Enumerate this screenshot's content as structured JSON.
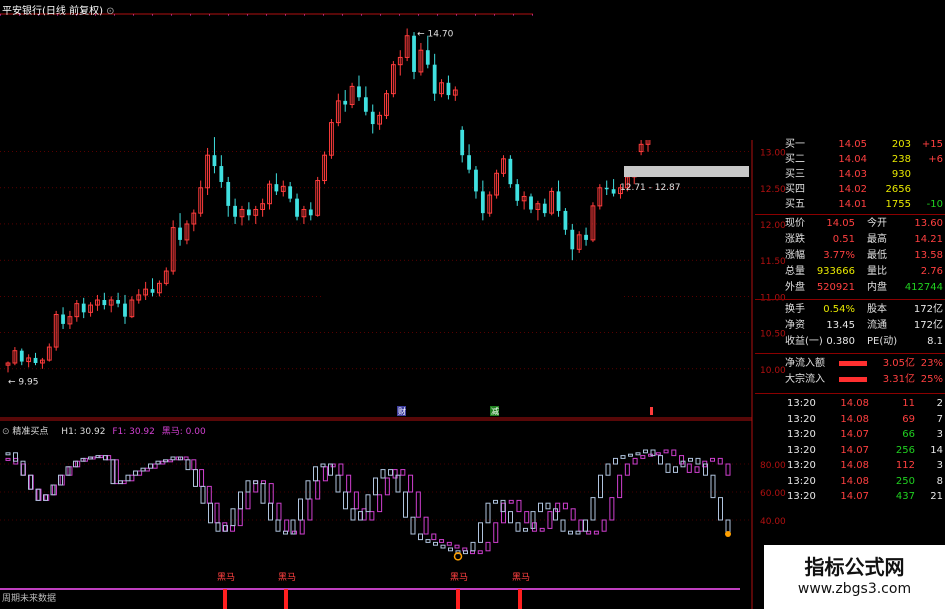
{
  "chart_title": "平安银行(日线 前复权)",
  "chart_data": [
    {
      "type": "candlestick",
      "title": "平安银行(日线 前复权)",
      "ylim": [
        9.5,
        14.9
      ],
      "y_ticks": [
        "13.00",
        "12.50",
        "12.00",
        "11.50",
        "11.00",
        "10.50",
        "10.00"
      ],
      "annotations": [
        "14.70",
        "9.95",
        "12.71 - 12.87"
      ],
      "markers": [
        "财",
        "减"
      ],
      "up_color": "#ff3c3c",
      "down_color": "#40e0e0",
      "candles": [
        [
          10.05,
          10.1,
          9.95,
          10.08
        ],
        [
          10.08,
          10.3,
          10.05,
          10.25
        ],
        [
          10.25,
          10.28,
          10.05,
          10.1
        ],
        [
          10.1,
          10.2,
          10.02,
          10.15
        ],
        [
          10.15,
          10.22,
          10.05,
          10.08
        ],
        [
          10.08,
          10.15,
          10.0,
          10.12
        ],
        [
          10.12,
          10.35,
          10.1,
          10.3
        ],
        [
          10.3,
          10.8,
          10.25,
          10.75
        ],
        [
          10.75,
          10.85,
          10.55,
          10.62
        ],
        [
          10.62,
          10.8,
          10.55,
          10.72
        ],
        [
          10.72,
          10.95,
          10.65,
          10.9
        ],
        [
          10.9,
          10.98,
          10.7,
          10.78
        ],
        [
          10.78,
          10.92,
          10.72,
          10.88
        ],
        [
          10.88,
          11.02,
          10.8,
          10.95
        ],
        [
          10.95,
          11.05,
          10.82,
          10.88
        ],
        [
          10.88,
          11.0,
          10.78,
          10.95
        ],
        [
          10.95,
          11.05,
          10.85,
          10.9
        ],
        [
          10.9,
          11.02,
          10.62,
          10.72
        ],
        [
          10.72,
          11.0,
          10.7,
          10.95
        ],
        [
          10.95,
          11.1,
          10.9,
          11.02
        ],
        [
          11.02,
          11.2,
          10.95,
          11.1
        ],
        [
          11.1,
          11.25,
          11.0,
          11.05
        ],
        [
          11.05,
          11.22,
          11.0,
          11.18
        ],
        [
          11.18,
          11.4,
          11.15,
          11.35
        ],
        [
          11.35,
          12.05,
          11.3,
          11.95
        ],
        [
          11.95,
          12.15,
          11.7,
          11.78
        ],
        [
          11.78,
          12.05,
          11.72,
          12.0
        ],
        [
          12.0,
          12.2,
          11.9,
          12.15
        ],
        [
          12.15,
          12.6,
          12.1,
          12.5
        ],
        [
          12.5,
          13.05,
          12.4,
          12.95
        ],
        [
          12.95,
          13.2,
          12.7,
          12.8
        ],
        [
          12.8,
          12.95,
          12.5,
          12.58
        ],
        [
          12.58,
          12.65,
          12.1,
          12.25
        ],
        [
          12.25,
          12.35,
          12.0,
          12.1
        ],
        [
          12.1,
          12.25,
          11.98,
          12.2
        ],
        [
          12.2,
          12.3,
          12.05,
          12.12
        ],
        [
          12.12,
          12.25,
          12.0,
          12.2
        ],
        [
          12.2,
          12.35,
          12.1,
          12.28
        ],
        [
          12.28,
          12.6,
          12.2,
          12.55
        ],
        [
          12.55,
          12.7,
          12.4,
          12.45
        ],
        [
          12.45,
          12.6,
          12.38,
          12.52
        ],
        [
          12.52,
          12.58,
          12.3,
          12.35
        ],
        [
          12.35,
          12.42,
          12.05,
          12.1
        ],
        [
          12.1,
          12.25,
          12.0,
          12.2
        ],
        [
          12.2,
          12.3,
          12.05,
          12.12
        ],
        [
          12.12,
          12.65,
          12.1,
          12.6
        ],
        [
          12.6,
          13.0,
          12.55,
          12.95
        ],
        [
          12.95,
          13.45,
          12.9,
          13.4
        ],
        [
          13.4,
          13.8,
          13.35,
          13.7
        ],
        [
          13.7,
          13.85,
          13.55,
          13.65
        ],
        [
          13.65,
          13.95,
          13.6,
          13.9
        ],
        [
          13.9,
          14.05,
          13.7,
          13.75
        ],
        [
          13.75,
          13.9,
          13.5,
          13.55
        ],
        [
          13.55,
          13.65,
          13.25,
          13.38
        ],
        [
          13.38,
          13.55,
          13.3,
          13.5
        ],
        [
          13.5,
          13.85,
          13.45,
          13.8
        ],
        [
          13.8,
          14.25,
          13.75,
          14.2
        ],
        [
          14.2,
          14.4,
          14.05,
          14.3
        ],
        [
          14.3,
          14.7,
          14.25,
          14.6
        ],
        [
          14.6,
          14.65,
          14.0,
          14.1
        ],
        [
          14.1,
          14.5,
          14.05,
          14.4
        ],
        [
          14.4,
          14.6,
          14.15,
          14.2
        ],
        [
          14.2,
          14.35,
          13.7,
          13.8
        ],
        [
          13.8,
          14.0,
          13.75,
          13.95
        ],
        [
          13.95,
          14.05,
          13.72,
          13.78
        ],
        [
          13.78,
          13.9,
          13.7,
          13.85
        ],
        [
          13.3,
          13.35,
          12.85,
          12.95
        ],
        [
          12.95,
          13.1,
          12.7,
          12.75
        ],
        [
          12.75,
          12.8,
          12.35,
          12.45
        ],
        [
          12.45,
          12.6,
          12.05,
          12.15
        ],
        [
          12.15,
          12.45,
          12.1,
          12.4
        ],
        [
          12.4,
          12.75,
          12.35,
          12.7
        ],
        [
          12.7,
          12.95,
          12.65,
          12.9
        ],
        [
          12.9,
          12.95,
          12.5,
          12.55
        ],
        [
          12.55,
          12.62,
          12.25,
          12.32
        ],
        [
          12.32,
          12.45,
          12.2,
          12.38
        ],
        [
          12.38,
          12.42,
          12.15,
          12.2
        ],
        [
          12.2,
          12.32,
          12.05,
          12.28
        ],
        [
          12.28,
          12.35,
          12.1,
          12.15
        ],
        [
          12.15,
          12.5,
          12.12,
          12.45
        ],
        [
          12.45,
          12.6,
          12.1,
          12.18
        ],
        [
          12.18,
          12.22,
          11.85,
          11.92
        ],
        [
          11.92,
          12.0,
          11.5,
          11.65
        ],
        [
          11.65,
          11.9,
          11.6,
          11.85
        ],
        [
          11.85,
          11.95,
          11.7,
          11.78
        ],
        [
          11.78,
          12.3,
          11.75,
          12.25
        ],
        [
          12.25,
          12.55,
          12.2,
          12.5
        ],
        [
          12.5,
          12.6,
          12.4,
          12.48
        ],
        [
          12.48,
          12.62,
          12.38,
          12.42
        ],
        [
          12.42,
          12.55,
          12.35,
          12.5
        ],
        [
          12.5,
          12.7,
          12.45,
          12.65
        ],
        [
          12.65,
          12.8,
          12.55,
          12.71
        ],
        [
          13.0,
          13.3,
          12.95,
          13.1
        ],
        [
          13.1,
          13.4,
          13.0,
          13.3
        ]
      ]
    },
    {
      "type": "line",
      "title": "精准买点",
      "legend": [
        "H1: 30.92",
        "F1: 30.92",
        "黑马: 0.00"
      ],
      "ylim": [
        0,
        100
      ],
      "y_ticks": [
        "80.00",
        "60.00",
        "40.00"
      ],
      "marker_label": "黑马",
      "marker_positions": [
        18,
        22,
        38,
        43
      ],
      "series": [
        {
          "name": "H1",
          "color": "#d040d0",
          "values": [
            84,
            80,
            72,
            62,
            54,
            58,
            65,
            72,
            78,
            82,
            84,
            85,
            86,
            83,
            66,
            68,
            72,
            75,
            77,
            80,
            82,
            83,
            85,
            83,
            76,
            64,
            52,
            38,
            32,
            36,
            48,
            60,
            68,
            66,
            52,
            40,
            32,
            30,
            40,
            55,
            68,
            78,
            80,
            72,
            60,
            48,
            40,
            46,
            58,
            70,
            76,
            72,
            60,
            42,
            30,
            26,
            24,
            22,
            20,
            18,
            16,
            18,
            24,
            38,
            52,
            54,
            46,
            38,
            32,
            34,
            46,
            52,
            48,
            40,
            32,
            30,
            32,
            40,
            56,
            72,
            80,
            84,
            86,
            87,
            88,
            90,
            86,
            80,
            74,
            78,
            82,
            84,
            80,
            72
          ]
        },
        {
          "name": "F1",
          "color": "#b0c4de",
          "values": [
            88,
            82,
            72,
            62,
            54,
            58,
            65,
            72,
            78,
            82,
            84,
            85,
            86,
            83,
            66,
            68,
            72,
            75,
            77,
            80,
            82,
            83,
            85,
            83,
            76,
            64,
            52,
            38,
            32,
            36,
            48,
            60,
            68,
            66,
            52,
            40,
            32,
            30,
            40,
            55,
            68,
            78,
            80,
            72,
            60,
            48,
            40,
            46,
            58,
            70,
            76,
            72,
            60,
            42,
            30,
            26,
            24,
            22,
            20,
            18,
            16,
            18,
            24,
            38,
            52,
            54,
            46,
            38,
            32,
            34,
            46,
            52,
            48,
            40,
            32,
            30,
            32,
            40,
            56,
            72,
            80,
            84,
            86,
            87,
            88,
            90,
            86,
            80,
            74,
            78,
            82,
            84,
            80,
            72,
            56,
            40,
            30
          ]
        }
      ]
    }
  ],
  "quote_panel": {
    "bids": [
      {
        "label": "买一",
        "price": "14.05",
        "vol": "203",
        "chg": "+15"
      },
      {
        "label": "买二",
        "price": "14.04",
        "vol": "238",
        "chg": "+6"
      },
      {
        "label": "买三",
        "price": "14.03",
        "vol": "930",
        "chg": ""
      },
      {
        "label": "买四",
        "price": "14.02",
        "vol": "2656",
        "chg": ""
      },
      {
        "label": "买五",
        "price": "14.01",
        "vol": "1755",
        "chg": "-10"
      }
    ],
    "stats": [
      {
        "l1": "现价",
        "v1": "14.05",
        "l2": "今开",
        "v2": "13.60"
      },
      {
        "l1": "涨跌",
        "v1": "0.51",
        "l2": "最高",
        "v2": "14.21"
      },
      {
        "l1": "涨幅",
        "v1": "3.77%",
        "l2": "最低",
        "v2": "13.58"
      },
      {
        "l1": "总量",
        "v1": "933666",
        "l2": "量比",
        "v2": "2.76"
      },
      {
        "l1": "外盘",
        "v1": "520921",
        "l2": "内盘",
        "v2": "412744"
      }
    ],
    "stats2": [
      {
        "l1": "换手",
        "v1": "0.54%",
        "l2": "股本",
        "v2": "172亿"
      },
      {
        "l1": "净资",
        "v1": "13.45",
        "l2": "流通",
        "v2": "172亿"
      },
      {
        "l1": "收益(一)",
        "v1": "0.380",
        "l2": "PE(动)",
        "v2": "8.1"
      }
    ],
    "flows": [
      {
        "label": "净流入额",
        "value": "3.05亿",
        "pct": "23%"
      },
      {
        "label": "大宗流入",
        "value": "3.31亿",
        "pct": "25%"
      }
    ],
    "ticks": [
      {
        "time": "13:20",
        "price": "14.08",
        "vol": "11",
        "dir": "2"
      },
      {
        "time": "13:20",
        "price": "14.08",
        "vol": "69",
        "dir": "7"
      },
      {
        "time": "13:20",
        "price": "14.07",
        "vol": "66",
        "dir": "3"
      },
      {
        "time": "13:20",
        "price": "14.07",
        "vol": "256",
        "dir": "14"
      },
      {
        "time": "13:20",
        "price": "14.08",
        "vol": "112",
        "dir": "3"
      },
      {
        "time": "13:20",
        "price": "14.08",
        "vol": "250",
        "dir": "8"
      },
      {
        "time": "13:20",
        "price": "14.07",
        "vol": "437",
        "dir": "21"
      }
    ]
  },
  "bottom_label": "周期未来数据",
  "watermark": {
    "line1": "指标公式网",
    "line2": "www.zbgs3.com"
  },
  "colors": {
    "up": "#ff3c3c",
    "down": "#40e0e0",
    "grid": "#8b0000",
    "axis": "#b01010"
  }
}
